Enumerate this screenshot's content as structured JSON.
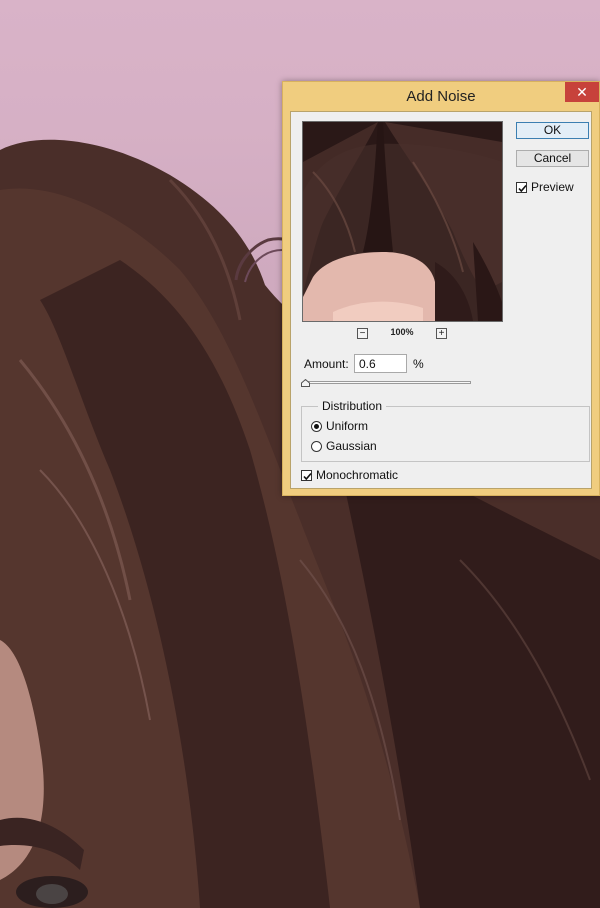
{
  "dialog": {
    "title": "Add Noise",
    "close_glyph": "✕",
    "ok_label": "OK",
    "cancel_label": "Cancel",
    "preview_label": "Preview",
    "preview_checked": true,
    "zoom_level": "100%",
    "zoom_out_glyph": "−",
    "zoom_in_glyph": "+",
    "amount_label": "Amount:",
    "amount_value": "0.6",
    "amount_unit": "%",
    "amount_slider_fraction": 0.0015,
    "distribution_label": "Distribution",
    "distribution_options": [
      "Uniform",
      "Gaussian"
    ],
    "distribution_selected": "Uniform",
    "monochromatic_label": "Monochromatic",
    "monochromatic_checked": true
  },
  "colors": {
    "titlebar": "#f0cd7f",
    "close_button": "#c7423b",
    "background_pink": "#d8b2c7",
    "hair_dark": "#3b2623"
  },
  "icons": {
    "close": "close-icon",
    "zoom_out": "zoom-out-icon",
    "zoom_in": "zoom-in-icon",
    "check": "checkmark-icon"
  }
}
